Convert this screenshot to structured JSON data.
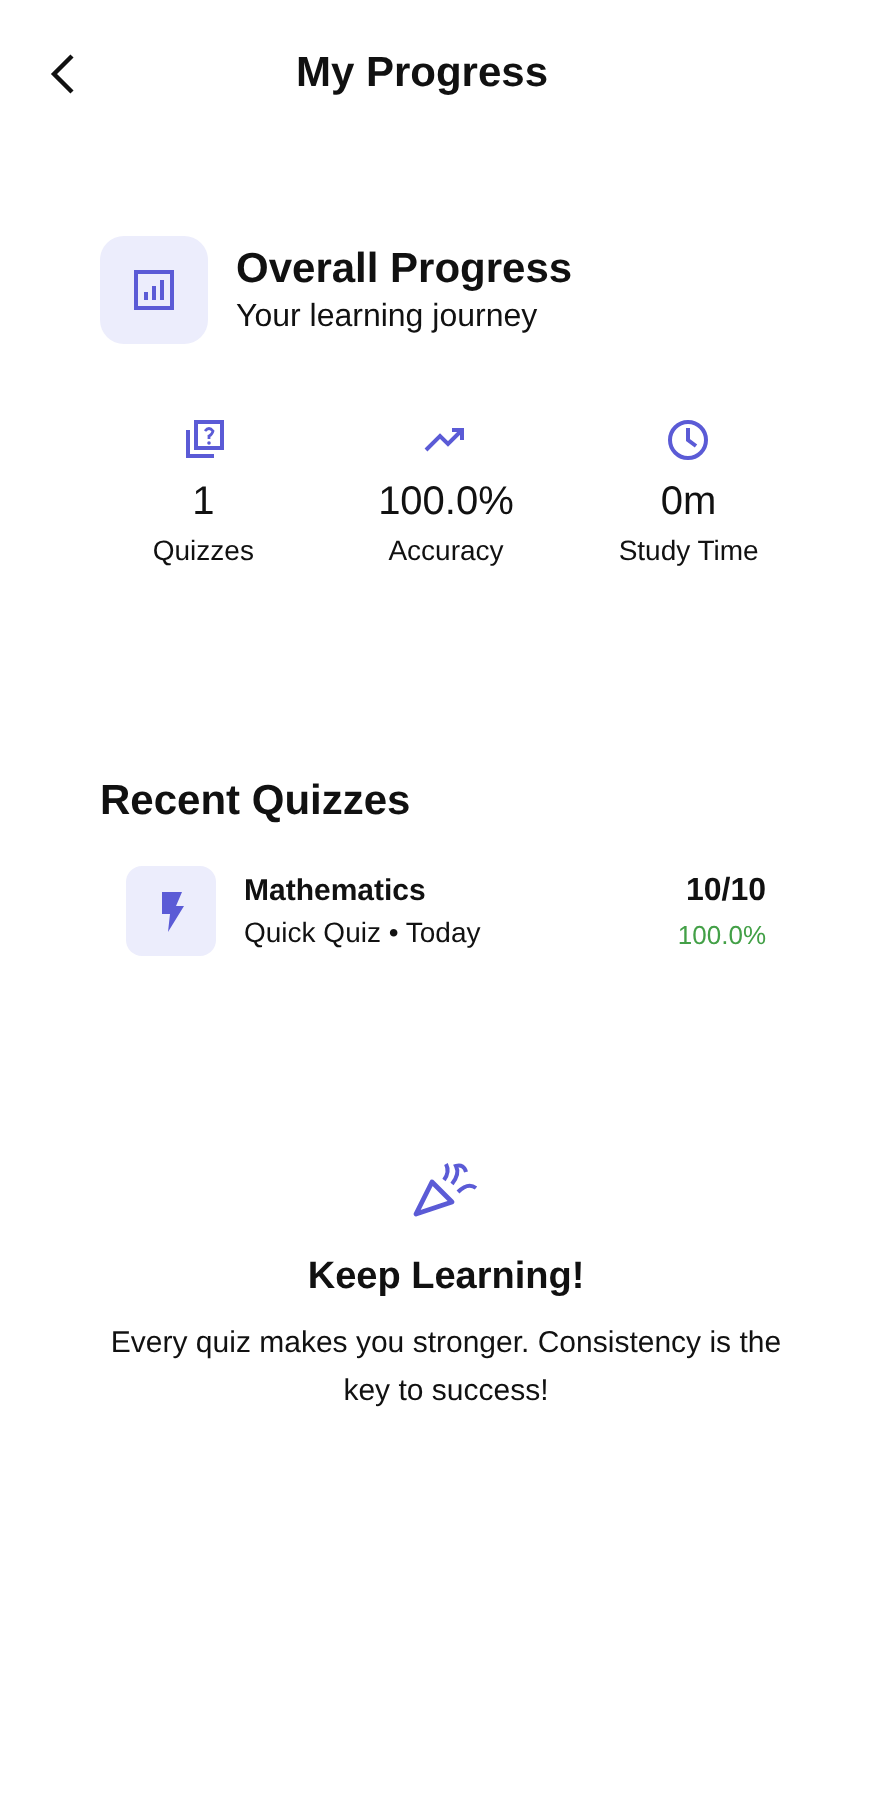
{
  "header": {
    "title": "My Progress"
  },
  "overview": {
    "title": "Overall Progress",
    "subtitle": "Your learning journey"
  },
  "stats": [
    {
      "kind": "quizzes",
      "value": "1",
      "label": "Quizzes"
    },
    {
      "kind": "accuracy",
      "value": "100.0%",
      "label": "Accuracy"
    },
    {
      "kind": "time",
      "value": "0m",
      "label": "Study Time"
    }
  ],
  "recent": {
    "title": "Recent Quizzes",
    "items": [
      {
        "subject": "Mathematics",
        "meta": "Quick Quiz • Today",
        "score": "10/10",
        "percent": "100.0%"
      }
    ]
  },
  "motivation": {
    "title": "Keep Learning!",
    "text": "Every quiz makes you stronger. Consistency is the key to success!"
  }
}
